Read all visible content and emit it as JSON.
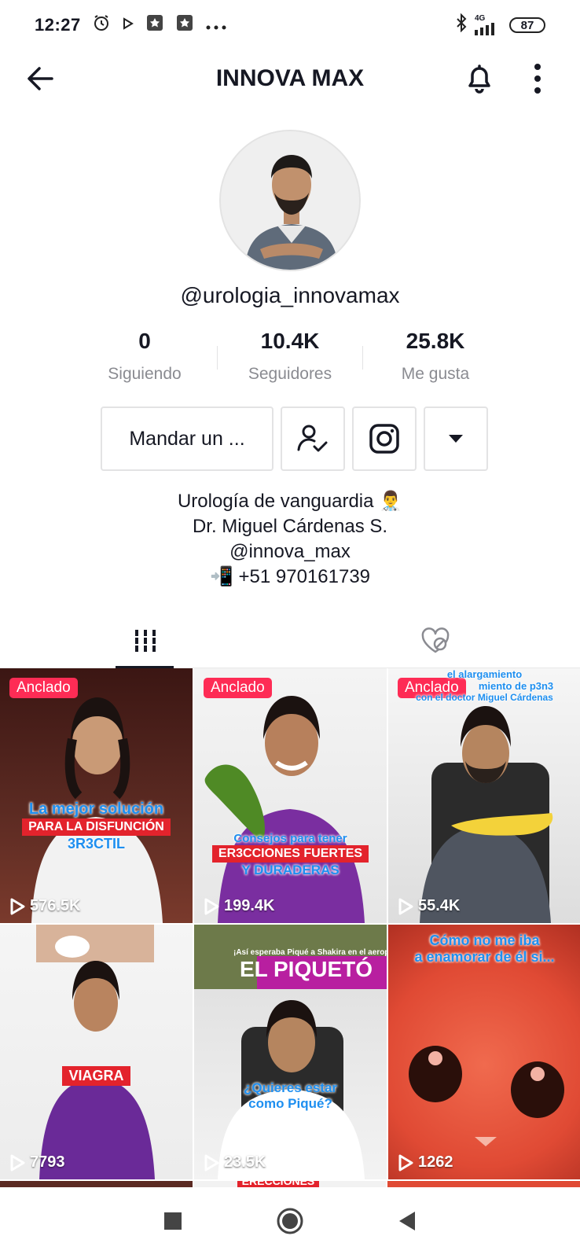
{
  "status_bar": {
    "time": "12:27",
    "network": "4G",
    "battery": "87",
    "icons": [
      "alarm-icon",
      "play-icon",
      "app-icon",
      "app-icon",
      "more-dots-icon",
      "bluetooth-icon",
      "signal-icon"
    ]
  },
  "header": {
    "title": "INNOVA MAX",
    "icons": [
      "back-arrow-icon",
      "bell-icon",
      "more-vertical-icon"
    ]
  },
  "profile": {
    "username": "@urologia_innovamax"
  },
  "stats": [
    {
      "value": "0",
      "label": "Siguiendo"
    },
    {
      "value": "10.4K",
      "label": "Seguidores"
    },
    {
      "value": "25.8K",
      "label": "Me gusta"
    }
  ],
  "actions": {
    "message_label": "Mandar un ...",
    "icons": [
      "following-user-icon",
      "instagram-icon",
      "dropdown-caret-icon"
    ]
  },
  "bio": {
    "lines": [
      "Urología de vanguardia 👨‍⚕️",
      "Dr. Miguel Cárdenas S.",
      "@innova_max",
      "📲 +51 970161739"
    ]
  },
  "tabs": {
    "icons": [
      "videos-grid-icon",
      "liked-videos-hidden-icon"
    ]
  },
  "videos": [
    {
      "pinned": "Anclado",
      "views": "576.5K",
      "caption_top": "La mejor solución",
      "caption_mid": "PARA LA DISFUNCIÓN",
      "caption_bot": "3R3CTIL"
    },
    {
      "pinned": "Anclado",
      "views": "199.4K",
      "caption_top": "Consejos para tener",
      "caption_mid": "ER3CCIONES FUERTES",
      "caption_bot": "Y DURADERAS"
    },
    {
      "pinned": "Anclado",
      "views": "55.4K",
      "caption_top": "el alargamiento",
      "caption_mid": "miento de p3n3",
      "caption_bot": "con el doctor Miguel Cárdenas"
    },
    {
      "pinned": "",
      "views": "7793",
      "caption_top": "",
      "caption_mid": "VIAGRA",
      "caption_bot": ""
    },
    {
      "pinned": "",
      "views": "23.5K",
      "caption_top": "¡Así esperaba Piqué a Shakira en el aeropue",
      "caption_mid": "EL PIQUETÓ",
      "caption_bot": "¿Quieres estar como Piqué?"
    },
    {
      "pinned": "",
      "views": "1262",
      "caption_top": "Cómo no me iba",
      "caption_mid": "a enamorar de él si...",
      "caption_bot": ""
    }
  ],
  "partial_caption": "ERECCIONES",
  "navbar": {
    "icons": [
      "recent-apps-icon",
      "home-icon",
      "back-triangle-icon"
    ]
  },
  "colors": {
    "pinned_badge": "#fe2c55",
    "text_primary": "#161823",
    "text_secondary": "#8a8b91",
    "caption_red": "#e3232c",
    "caption_blue": "#1e8ff0"
  }
}
